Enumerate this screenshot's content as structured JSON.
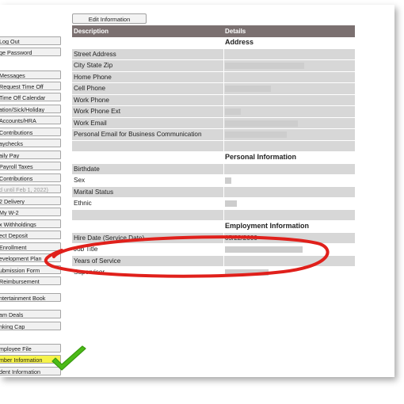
{
  "edit_button_label": "Edit Information",
  "table": {
    "headers": {
      "description": "Description",
      "details": "Details"
    },
    "sections": {
      "address": "Address",
      "personal": "Personal Information",
      "employment": "Employment Information"
    },
    "rows": {
      "street_address": "Street Address",
      "city_state_zip": "City State Zip",
      "home_phone": "Home Phone",
      "cell_phone": "Cell Phone",
      "work_phone": "Work Phone",
      "work_phone_ext": "Work Phone Ext",
      "work_email": "Work Email",
      "personal_email": "Personal Email for Business Communication",
      "birthdate": "Birthdate",
      "sex": "Sex",
      "marital_status": "Marital Status",
      "ethnic": "Ethnic",
      "hire_date": "Hire Date (Service Date)",
      "job_title": "Job Title",
      "years_of_service": "Years of Service",
      "supervisor": "Supervisor"
    },
    "values": {
      "hire_date": "05/22/2000"
    }
  },
  "sidebar": {
    "items": [
      "Log Out",
      "ge Password",
      "Messages",
      "Request Time Off",
      "Time Off Calendar",
      "ation/Sick/Holiday",
      "Accounts/HRA",
      "Contributions",
      "aychecks",
      "aily Pay",
      "Payroll Taxes",
      "Contributions",
      "d until Feb 1, 2022)",
      "2 Delivery",
      "My W-2",
      "x Withholdings",
      "ect Deposit",
      "Enrollment",
      "evelopment Plan",
      "ubmission Form",
      "Reimbursement",
      "ntertainment Book",
      "am Deals",
      "nking Cap",
      "mployee File",
      "mber Information",
      "dent Information"
    ]
  },
  "colors": {
    "header_bg": "#7b7070",
    "row_gray": "#d7d7d7",
    "highlight": "#f6f34a",
    "oval_red": "#e0201b",
    "check_green": "#4cbb17"
  },
  "icons": {
    "checkmark": "green-checkmark-icon"
  }
}
